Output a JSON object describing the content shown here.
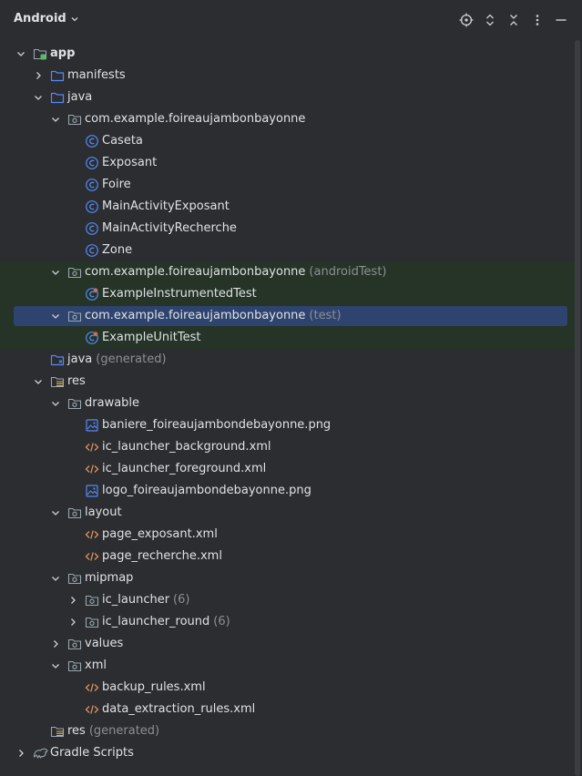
{
  "header": {
    "view_mode": "Android"
  },
  "toolbar": [
    {
      "name": "locate-icon"
    },
    {
      "name": "expand-all-icon"
    },
    {
      "name": "collapse-all-icon"
    },
    {
      "name": "options-icon"
    },
    {
      "name": "hide-icon"
    }
  ],
  "tree": [
    {
      "label": "app",
      "suffix": "",
      "level": 0,
      "arrow": "down",
      "icon": "module",
      "bold": true
    },
    {
      "label": "manifests",
      "suffix": "",
      "level": 1,
      "arrow": "right",
      "icon": "folder"
    },
    {
      "label": "java",
      "suffix": "",
      "level": 1,
      "arrow": "down",
      "icon": "folder"
    },
    {
      "label": "com.example.foireaujambonbayonne",
      "suffix": "",
      "level": 2,
      "arrow": "down",
      "icon": "package"
    },
    {
      "label": "Caseta",
      "suffix": "",
      "level": 3,
      "arrow": "",
      "icon": "class"
    },
    {
      "label": "Exposant",
      "suffix": "",
      "level": 3,
      "arrow": "",
      "icon": "class"
    },
    {
      "label": "Foire",
      "suffix": "",
      "level": 3,
      "arrow": "",
      "icon": "class"
    },
    {
      "label": "MainActivityExposant",
      "suffix": "",
      "level": 3,
      "arrow": "",
      "icon": "class"
    },
    {
      "label": "MainActivityRecherche",
      "suffix": "",
      "level": 3,
      "arrow": "",
      "icon": "class"
    },
    {
      "label": "Zone",
      "suffix": "",
      "level": 3,
      "arrow": "",
      "icon": "class"
    },
    {
      "label": "com.example.foireaujambonbayonne",
      "suffix": "(androidTest)",
      "level": 2,
      "arrow": "down",
      "icon": "package",
      "band": true
    },
    {
      "label": "ExampleInstrumentedTest",
      "suffix": "",
      "level": 3,
      "arrow": "",
      "icon": "testclass",
      "band": true
    },
    {
      "label": "com.example.foireaujambonbayonne",
      "suffix": "(test)",
      "level": 2,
      "arrow": "down",
      "icon": "package",
      "band": true,
      "selected": true
    },
    {
      "label": "ExampleUnitTest",
      "suffix": "",
      "level": 3,
      "arrow": "",
      "icon": "testclass",
      "band": true
    },
    {
      "label": "java",
      "suffix": "(generated)",
      "level": 1,
      "arrow": "",
      "icon": "genfolder"
    },
    {
      "label": "res",
      "suffix": "",
      "level": 1,
      "arrow": "down",
      "icon": "resfolder"
    },
    {
      "label": "drawable",
      "suffix": "",
      "level": 2,
      "arrow": "down",
      "icon": "package"
    },
    {
      "label": "baniere_foireaujambondebayonne.png",
      "suffix": "",
      "level": 3,
      "arrow": "",
      "icon": "image"
    },
    {
      "label": "ic_launcher_background.xml",
      "suffix": "",
      "level": 3,
      "arrow": "",
      "icon": "xml"
    },
    {
      "label": "ic_launcher_foreground.xml",
      "suffix": "",
      "level": 3,
      "arrow": "",
      "icon": "xml"
    },
    {
      "label": "logo_foireaujambondebayonne.png",
      "suffix": "",
      "level": 3,
      "arrow": "",
      "icon": "image"
    },
    {
      "label": "layout",
      "suffix": "",
      "level": 2,
      "arrow": "down",
      "icon": "package"
    },
    {
      "label": "page_exposant.xml",
      "suffix": "",
      "level": 3,
      "arrow": "",
      "icon": "xml"
    },
    {
      "label": "page_recherche.xml",
      "suffix": "",
      "level": 3,
      "arrow": "",
      "icon": "xml"
    },
    {
      "label": "mipmap",
      "suffix": "",
      "level": 2,
      "arrow": "down",
      "icon": "package"
    },
    {
      "label": "ic_launcher",
      "suffix": "(6)",
      "level": 3,
      "arrow": "right",
      "icon": "package"
    },
    {
      "label": "ic_launcher_round",
      "suffix": "(6)",
      "level": 3,
      "arrow": "right",
      "icon": "package"
    },
    {
      "label": "values",
      "suffix": "",
      "level": 2,
      "arrow": "right",
      "icon": "package"
    },
    {
      "label": "xml",
      "suffix": "",
      "level": 2,
      "arrow": "down",
      "icon": "package"
    },
    {
      "label": "backup_rules.xml",
      "suffix": "",
      "level": 3,
      "arrow": "",
      "icon": "xml"
    },
    {
      "label": "data_extraction_rules.xml",
      "suffix": "",
      "level": 3,
      "arrow": "",
      "icon": "xml"
    },
    {
      "label": "res",
      "suffix": "(generated)",
      "level": 1,
      "arrow": "",
      "icon": "resfolder"
    },
    {
      "label": "Gradle Scripts",
      "suffix": "",
      "level": 0,
      "arrow": "right",
      "icon": "gradle"
    }
  ],
  "colors": {
    "background": "#2b2d30",
    "text": "#dfe1e5",
    "muted": "#8c8f94",
    "selection": "#2e436e",
    "test_band": "#253427",
    "class_icon": "#548af7",
    "xml_icon": "#e0915a",
    "module_badge": "#5fb865"
  }
}
